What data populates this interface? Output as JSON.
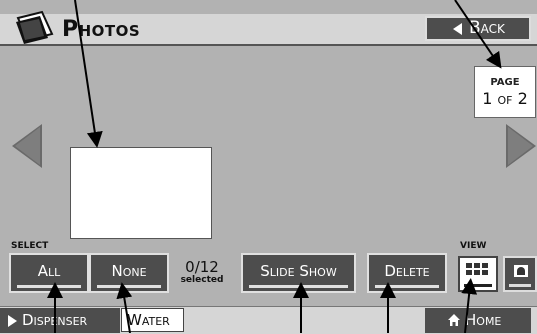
{
  "header": {
    "title": "Photos",
    "back_label": "Back"
  },
  "pagination": {
    "label": "PAGE",
    "current": "1",
    "of": "OF",
    "total": "2"
  },
  "selection": {
    "section_label": "SELECT",
    "all_label": "All",
    "none_label": "None",
    "count": "0/12",
    "count_caption": "selected"
  },
  "actions": {
    "slideshow_label": "Slide Show",
    "delete_label": "Delete"
  },
  "view": {
    "section_label": "VIEW",
    "selected_mode": "grid"
  },
  "footer": {
    "dispenser_label": "Dispenser",
    "water_label": "Water",
    "home_label": "Home"
  },
  "icons": {
    "title": "photos-icon",
    "back": "back-triangle-icon",
    "prev": "prev-page-arrow-icon",
    "next": "next-page-arrow-icon",
    "grid": "grid-view-icon",
    "single": "single-photo-view-icon",
    "dispenser": "play-triangle-icon",
    "home": "home-icon"
  }
}
